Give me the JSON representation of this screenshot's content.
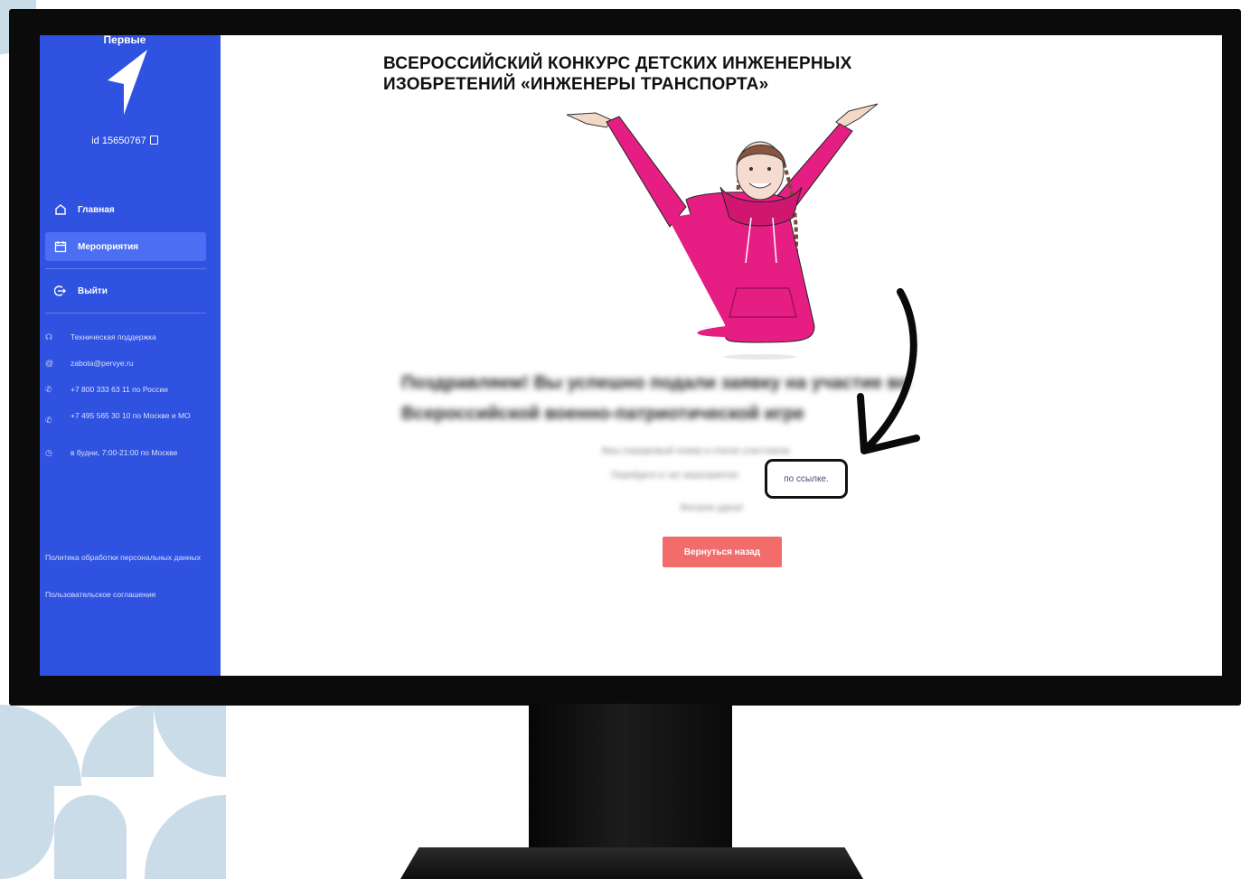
{
  "headline": {
    "line1": "ВСЕРОССИЙСКИЙ КОНКУРС ДЕТСКИХ ИНЖЕНЕРНЫХ",
    "line2": "ИЗОБРЕТЕНИЙ «ИНЖЕНЕРЫ  ТРАНСПОРТА»"
  },
  "sidebar": {
    "brand": "Первые",
    "user_id": "id 15650767",
    "nav": [
      {
        "label": "Главная",
        "icon": "home-icon",
        "active": false
      },
      {
        "label": "Мероприятия",
        "icon": "calendar-icon",
        "active": true
      },
      {
        "label": "Выйти",
        "icon": "logout-icon",
        "active": false
      }
    ],
    "contacts": [
      {
        "icon": "headset-icon",
        "text": "Техническая поддержка"
      },
      {
        "icon": "at-icon",
        "text": "zabota@pervye.ru"
      },
      {
        "icon": "phone-icon",
        "text": "+7 800 333 63 11 по России"
      },
      {
        "icon": "phone-icon",
        "text": "+7 495 565 30 10 по Москве и МО"
      },
      {
        "icon": "clock-icon",
        "text": "в будни, 7:00-21:00 по Москве"
      }
    ],
    "footer_links": [
      "Политика обработки персональных данных",
      "Пользовательское соглашение"
    ]
  },
  "main": {
    "blurred_title_line1": "Поздравляем! Вы успешно подали заявку на участие во",
    "blurred_title_line2": "Всероссийской военно-патриотической игре",
    "blurred_info_line1": "Ваш порядковый номер в списке участников",
    "blurred_info_line2": "Перейдите в чат мероприятия",
    "link_text": "по ссылке.",
    "blurred_info_line3": "Желаем удачи!",
    "back_button": "Вернуться назад"
  },
  "colors": {
    "sidebar": "#2f52e0",
    "active_nav": "#4b6ef2",
    "button": "#f36c6c",
    "hoodie": "#e61e84",
    "monitor": "#0b0b0b",
    "pattern": "#c9dce8"
  }
}
